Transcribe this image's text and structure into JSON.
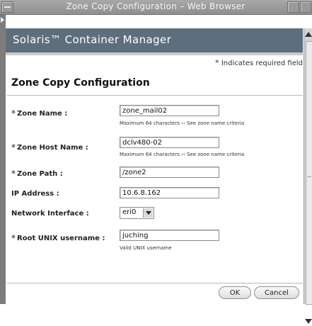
{
  "window": {
    "title": "Zone Copy Configuration – Web Browser"
  },
  "header": {
    "brand": "Solaris™ Container Manager"
  },
  "required_note": {
    "asterisk": "*",
    "text": "Indicates required field"
  },
  "page_title": "Zone Copy Configuration",
  "form": {
    "zone_name": {
      "required": "*",
      "label": "Zone Name :",
      "value": "zone_mail02",
      "hint": "Maximum 64 characters ››   See zone name criteria"
    },
    "zone_host_name": {
      "required": "*",
      "label": "Zone Host Name :",
      "value": "dclv480-02",
      "hint": "Maximum 64 characters ››   See zone name criteria"
    },
    "zone_path": {
      "required": "*",
      "label": "Zone Path :",
      "value": "/zone2"
    },
    "ip_address": {
      "label": "IP Address :",
      "value": "10.6.8.162"
    },
    "network_interface": {
      "label": "Network Interface :",
      "selected": "eri0"
    },
    "root_unix_username": {
      "required": "*",
      "label": "Root UNIX username :",
      "value": "juching",
      "hint": "Valid UNIX username"
    }
  },
  "buttons": {
    "ok": "OK",
    "cancel": "Cancel"
  },
  "icons": {
    "window_menu": "window-menu-icon",
    "dropdown": "chevron-down-icon",
    "scroll_up": "scroll-up-icon",
    "scroll_down": "scroll-down-icon"
  }
}
